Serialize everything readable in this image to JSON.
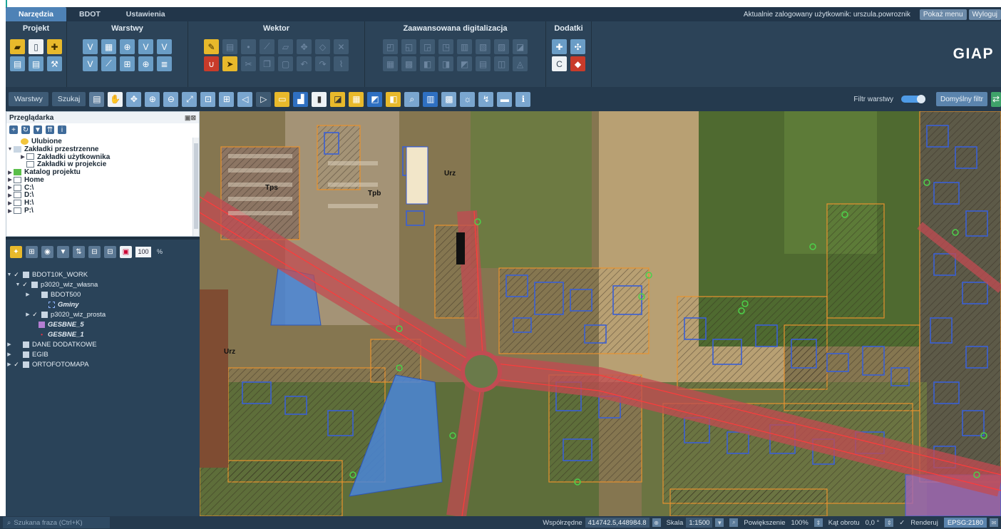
{
  "menu": {
    "tabs": [
      "Narzędzia",
      "BDOT",
      "Ustawienia"
    ],
    "active_tab": 0,
    "user_text": "Aktualnie zalogowany użytkownik: urszula.powroznik",
    "show_menu": "Pokaż menu",
    "logout": "Wyloguj"
  },
  "ribbon": {
    "groups": [
      "Projekt",
      "Warstwy",
      "Wektor",
      "Zaawansowana digitalizacja",
      "Dodatki"
    ],
    "logo": "GIAP"
  },
  "toolbar": {
    "layers_btn": "Warstwy",
    "search_btn": "Szukaj",
    "filter_label": "Filtr warstwy",
    "default_filter": "Domyślny filtr"
  },
  "browser": {
    "title": "Przeglądarka",
    "items": [
      "Ulubione",
      "Zakładki przestrzenne",
      "Zakładki użytkownika",
      "Zakładki w projekcie",
      "Katalog projektu",
      "Home",
      "C:\\",
      "D:\\",
      "H:\\",
      "P:\\"
    ]
  },
  "layers": {
    "opacity": "100",
    "pct": "%",
    "items": [
      "BDOT10K_WORK",
      "p3020_wiz_własna",
      "BDOT500",
      "Gminy",
      "p3020_wiz_prosta",
      "GESBNE_5",
      "GESBNE_1",
      "DANE DODATKOWE",
      "EGIB",
      "ORTOFOTOMAPA"
    ]
  },
  "map": {
    "labels": [
      "Tps",
      "Tpb",
      "Urz",
      "Urz"
    ]
  },
  "status": {
    "search_placeholder": "Szukana fraza (Ctrl+K)",
    "coords_label": "Współrzędne",
    "coords_value": "414742.5,448984.8",
    "scale_label": "Skala",
    "scale_value": "1:1500",
    "zoom_label": "Powiększenie",
    "zoom_value": "100%",
    "rotation_label": "Kąt obrotu",
    "rotation_value": "0,0 °",
    "render_label": "Renderuj",
    "epsg": "EPSG:2180"
  },
  "colors": {
    "roads": "#e23a3a",
    "parcels_blue": "#3a5fd6",
    "parcels_orange": "#e8922e",
    "fill_blue": "#4a86d8",
    "tree_green": "#4cd14a"
  }
}
